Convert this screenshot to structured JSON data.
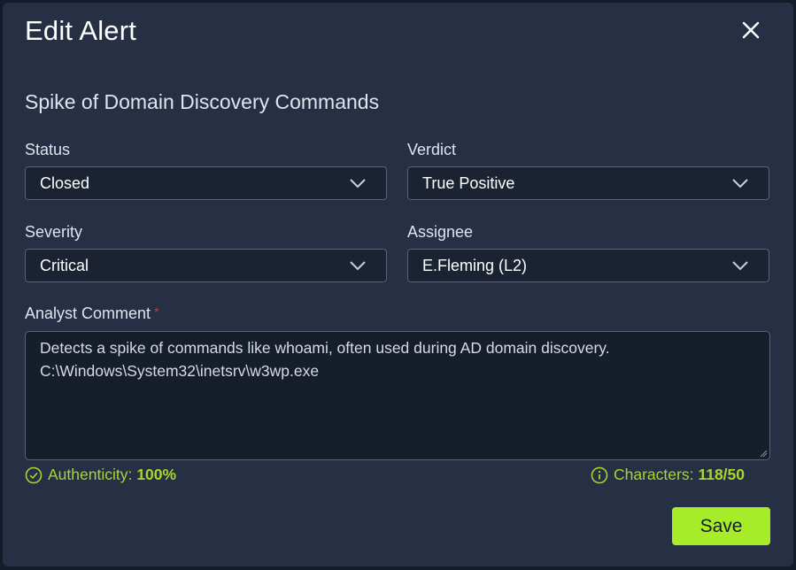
{
  "modal": {
    "title": "Edit Alert",
    "alert_name": "Spike of Domain Discovery Commands"
  },
  "fields": {
    "status": {
      "label": "Status",
      "value": "Closed"
    },
    "verdict": {
      "label": "Verdict",
      "value": "True Positive"
    },
    "severity": {
      "label": "Severity",
      "value": "Critical"
    },
    "assignee": {
      "label": "Assignee",
      "value": "E.Fleming (L2)"
    }
  },
  "comment": {
    "label": "Analyst Comment",
    "required_marker": "*",
    "lines": [
      "Detects a spike of commands like whoami, often used during AD domain discovery.",
      "C:\\Windows\\System32\\inetsrv\\w3wp.exe"
    ]
  },
  "metrics": {
    "authenticity_label": "Authenticity:",
    "authenticity_value": "100%",
    "characters_label": "Characters:",
    "characters_value": "118/50"
  },
  "actions": {
    "save_label": "Save"
  },
  "colors": {
    "accent": "#a6ec29",
    "required": "#e0303a",
    "modal_bg": "#262f44"
  },
  "icons": {
    "close": "close-icon",
    "dropdown": "chevron-down-icon",
    "authenticity": "check-circle-icon",
    "info": "info-circle-icon"
  }
}
